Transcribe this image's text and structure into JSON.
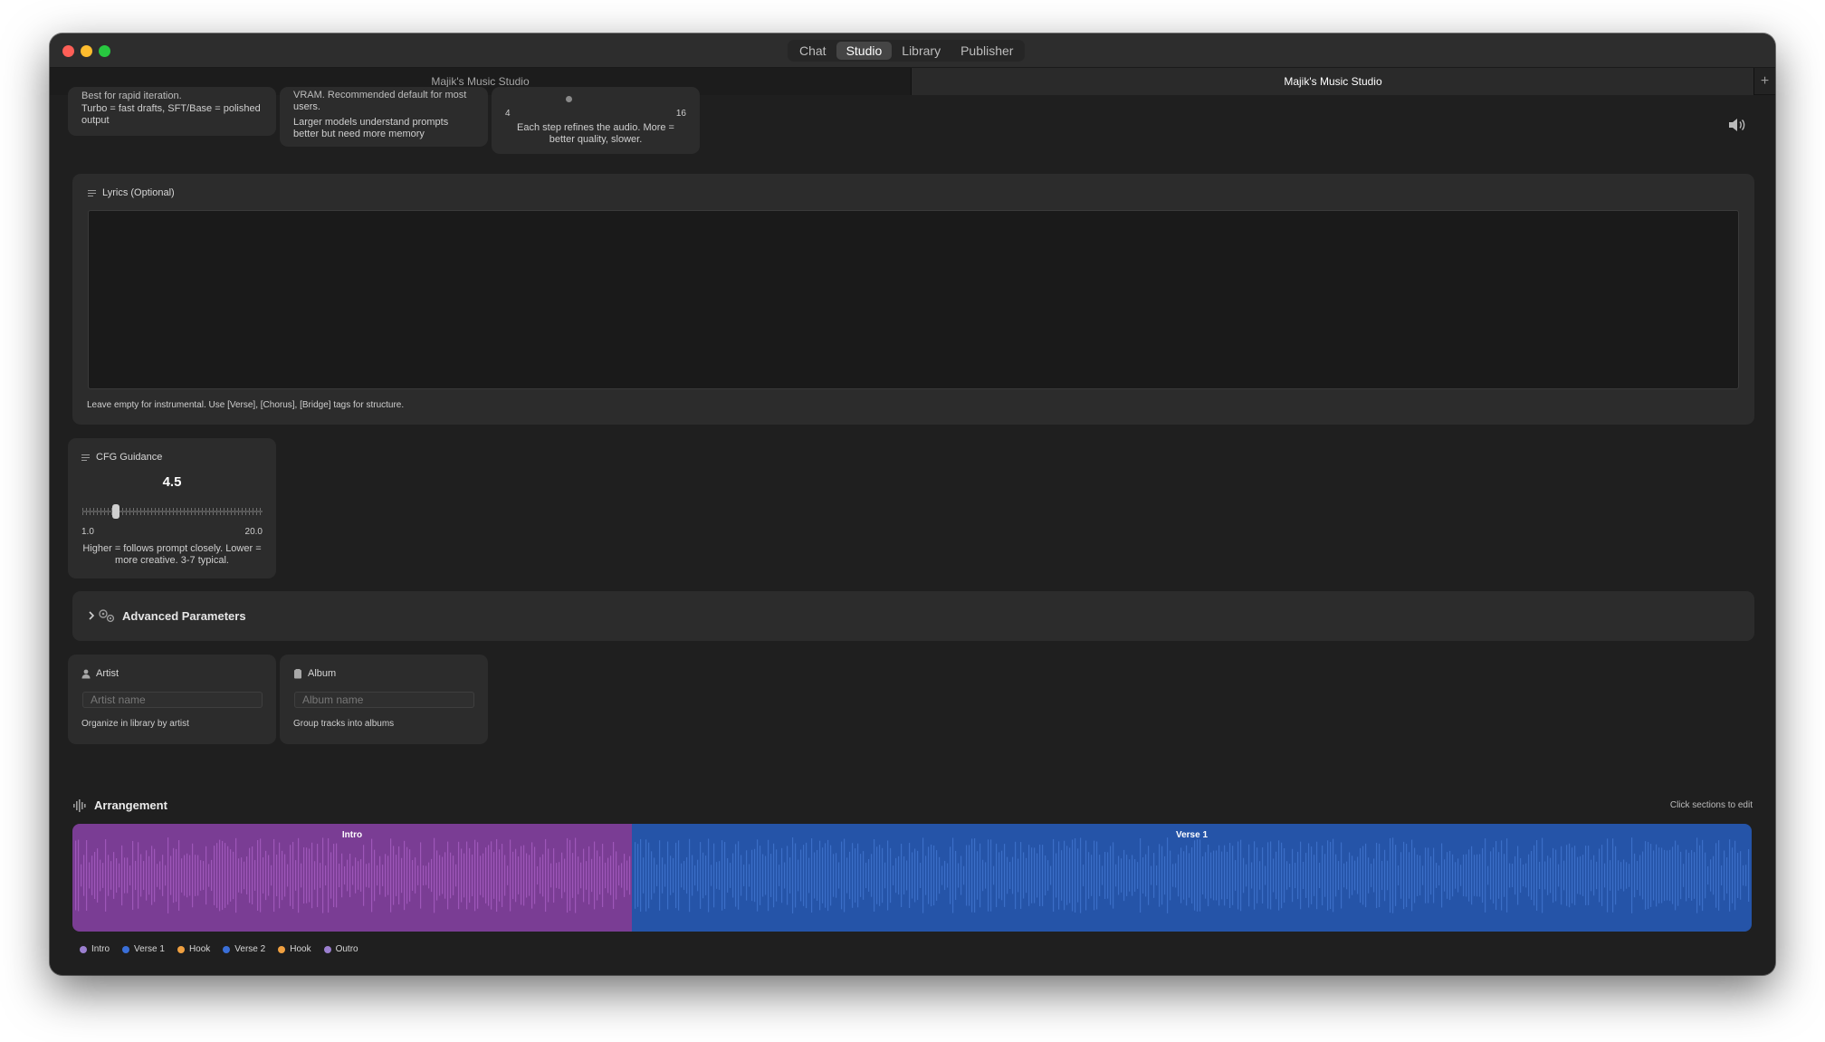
{
  "titlebar": {
    "tabs": [
      {
        "label": "Chat",
        "active": false
      },
      {
        "label": "Studio",
        "active": true
      },
      {
        "label": "Library",
        "active": false
      },
      {
        "label": "Publisher",
        "active": false
      }
    ]
  },
  "doc_tabs": {
    "tab1": "Majik's Music Studio",
    "tab2": "Majik's Music Studio",
    "add": "+"
  },
  "top_cards": {
    "card1": {
      "clipped_line": "Best for rapid iteration.",
      "help": "Turbo = fast drafts, SFT/Base = polished output"
    },
    "card2": {
      "clipped_line_1": "VRAM. Recommended default for most",
      "clipped_line_2": "users.",
      "help": "Larger models understand prompts better but need more memory"
    },
    "card3": {
      "min": "4",
      "max": "16",
      "help": "Each step refines the audio. More = better quality, slower."
    }
  },
  "lyrics": {
    "label": "Lyrics (Optional)",
    "value": "",
    "help": "Leave empty for instrumental. Use [Verse], [Chorus], [Bridge] tags for structure."
  },
  "cfg": {
    "label": "CFG Guidance",
    "value": "4.5",
    "min": "1.0",
    "max": "20.0",
    "help": "Higher = follows prompt closely. Lower = more creative. 3-7 typical."
  },
  "advanced": {
    "label": "Advanced Parameters",
    "expanded": false
  },
  "artist": {
    "label": "Artist",
    "placeholder": "Artist name",
    "help": "Organize in library by artist"
  },
  "album": {
    "label": "Album",
    "placeholder": "Album name",
    "help": "Group tracks into albums"
  },
  "arrangement": {
    "title": "Arrangement",
    "hint": "Click sections to edit",
    "sections": [
      {
        "label": "Intro",
        "color": "#7a3d94",
        "wave_color": "#a45cc0"
      },
      {
        "label": "Verse 1",
        "color": "#2554a8",
        "wave_color": "#3f73cc"
      }
    ],
    "legend": [
      {
        "label": "Intro",
        "color": "#9b7fcf"
      },
      {
        "label": "Verse 1",
        "color": "#3a6fd8"
      },
      {
        "label": "Hook",
        "color": "#f0a040"
      },
      {
        "label": "Verse 2",
        "color": "#3a6fd8"
      },
      {
        "label": "Hook",
        "color": "#f0a040"
      },
      {
        "label": "Outro",
        "color": "#9b7fcf"
      }
    ]
  },
  "icons": {
    "volume": "speaker-icon",
    "chevron": "chevron-right-icon",
    "advanced": "gears-icon",
    "artist": "person-icon",
    "album": "album-icon",
    "arrangement": "waveform-icon"
  }
}
